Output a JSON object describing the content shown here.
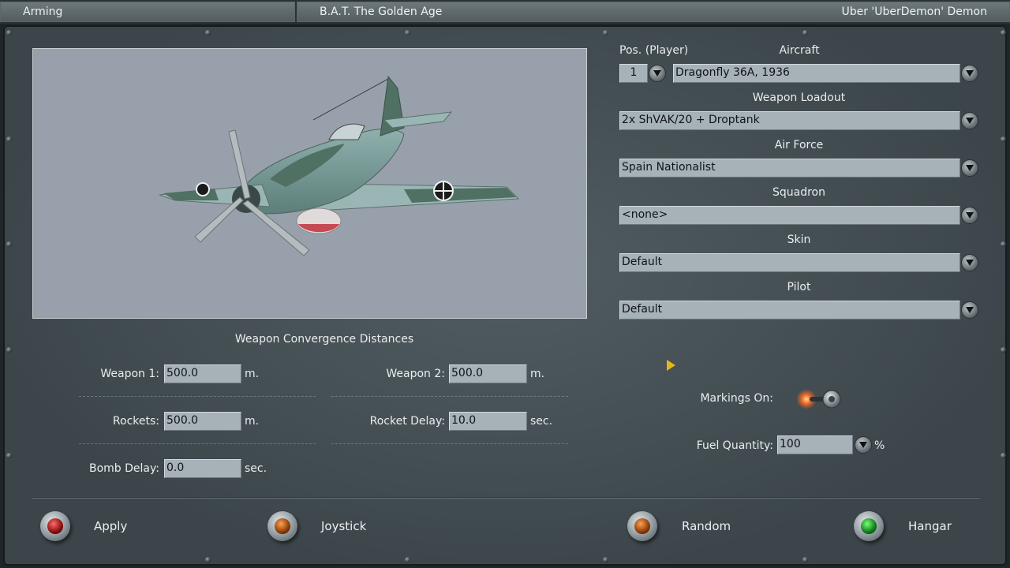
{
  "header": {
    "left": "Arming",
    "center": "B.A.T. The Golden Age",
    "right": "Uber 'UberDemon' Demon"
  },
  "loadout": {
    "pos_label": "Pos. (Player)",
    "pos_value": "1",
    "aircraft_label": "Aircraft",
    "aircraft_value": "Dragonfly 36A, 1936",
    "weapon_loadout_label": "Weapon Loadout",
    "weapon_loadout_value": "2x ShVAK/20 + Droptank",
    "air_force_label": "Air Force",
    "air_force_value": "Spain Nationalist",
    "squadron_label": "Squadron",
    "squadron_value": "<none>",
    "skin_label": "Skin",
    "skin_value": "Default",
    "pilot_label": "Pilot",
    "pilot_value": "Default"
  },
  "convergence": {
    "title": "Weapon Convergence Distances",
    "weapon1_label": "Weapon 1:",
    "weapon1_value": "500.0",
    "weapon1_unit": "m.",
    "weapon2_label": "Weapon 2:",
    "weapon2_value": "500.0",
    "weapon2_unit": "m.",
    "rockets_label": "Rockets:",
    "rockets_value": "500.0",
    "rockets_unit": "m.",
    "rocket_delay_label": "Rocket Delay:",
    "rocket_delay_value": "10.0",
    "rocket_delay_unit": "sec.",
    "bomb_delay_label": "Bomb Delay:",
    "bomb_delay_value": "0.0",
    "bomb_delay_unit": "sec."
  },
  "options": {
    "markings_label": "Markings On:",
    "markings_on": true,
    "fuel_label": "Fuel Quantity:",
    "fuel_value": "100",
    "fuel_unit": "%"
  },
  "footer": {
    "apply": "Apply",
    "joystick": "Joystick",
    "random": "Random",
    "hangar": "Hangar"
  },
  "colors": {
    "panel": "#48545a",
    "viewer_bg": "#98a1ab",
    "field_bg": "#a7b1b8",
    "lamp_red": "#c41616",
    "lamp_amber": "#d0600e",
    "lamp_green": "#1dbb2c",
    "cursor": "#e6b815"
  },
  "icons": {
    "dropdown": "chevron-down-icon",
    "toggle": "toggle-switch-icon",
    "cursor": "pointer-cursor-icon"
  }
}
